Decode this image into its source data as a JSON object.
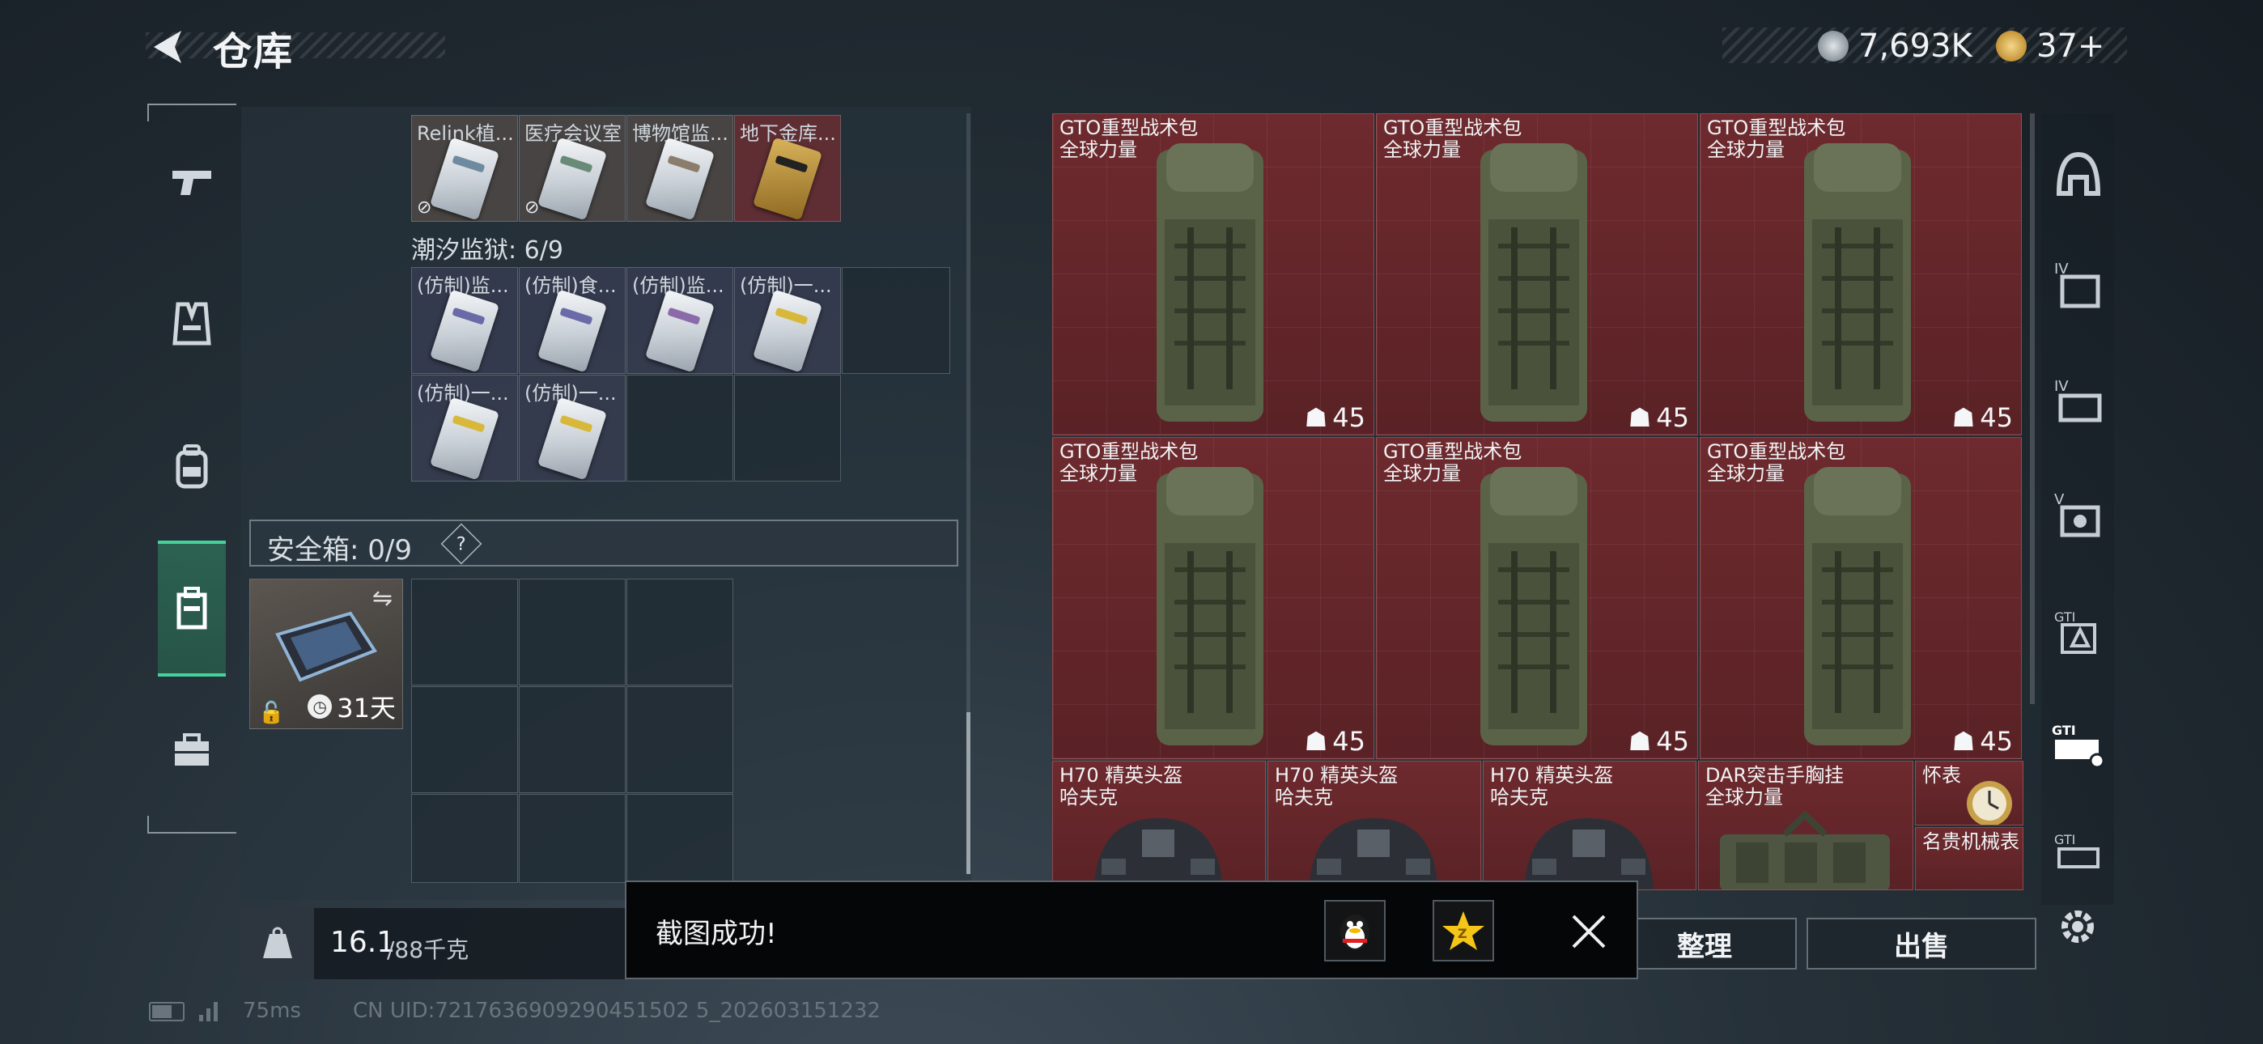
{
  "header": {
    "title": "仓库",
    "currency_primary": "7,693K",
    "currency_secondary": "37+"
  },
  "left_nav": [
    {
      "icon": "pistol-icon"
    },
    {
      "icon": "vest-icon"
    },
    {
      "icon": "backpack-icon"
    },
    {
      "icon": "container-icon",
      "active": true
    },
    {
      "icon": "briefcase-icon"
    }
  ],
  "storage": {
    "top_row_labels": [
      "Relink植...",
      "医疗会议室",
      "博物馆监...",
      "地下金库..."
    ],
    "prison_title": "潮汐监狱: 6/9",
    "prison_items": [
      "(仿制)监...",
      "(仿制)食...",
      "(仿制)监...",
      "(仿制)一...",
      "(仿制)一...",
      "(仿制)一..."
    ],
    "safebox_title": "安全箱: 0/9",
    "safebox_help": "?",
    "safebox_days": "31天",
    "weight_current": "16.1",
    "weight_max": "/88千克"
  },
  "items": {
    "backpacks": [
      {
        "name": "GTO重型战术包",
        "brand": "全球力量",
        "count": "45"
      },
      {
        "name": "GTO重型战术包",
        "brand": "全球力量",
        "count": "45"
      },
      {
        "name": "GTO重型战术包",
        "brand": "全球力量",
        "count": "45"
      },
      {
        "name": "GTO重型战术包",
        "brand": "全球力量",
        "count": "45"
      },
      {
        "name": "GTO重型战术包",
        "brand": "全球力量",
        "count": "45"
      },
      {
        "name": "GTO重型战术包",
        "brand": "全球力量",
        "count": "45"
      }
    ],
    "bottom_row": [
      {
        "name": "H70 精英头盔",
        "brand": "哈夫克"
      },
      {
        "name": "H70 精英头盔",
        "brand": "哈夫克"
      },
      {
        "name": "H70 精英头盔",
        "brand": "哈夫克"
      },
      {
        "name": "DAR突击手胸挂",
        "brand": "全球力量"
      },
      {
        "name": "怀表",
        "brand": ""
      },
      {
        "name": "名贵机械表",
        "brand": ""
      }
    ]
  },
  "right_nav": [
    {
      "icon": "helmet-category-icon"
    },
    {
      "icon": "armor-iv-icon",
      "label": "IV"
    },
    {
      "icon": "rig-iv-icon",
      "label": "IV"
    },
    {
      "icon": "armor-v-icon",
      "label": "V"
    },
    {
      "icon": "gti-armor-icon",
      "label": "GTI"
    },
    {
      "icon": "gti-rig-icon",
      "label": "GTI"
    },
    {
      "icon": "gti-backpack-icon",
      "label": "GTI"
    }
  ],
  "buttons": {
    "organize": "整理",
    "sell": "出售"
  },
  "toast": {
    "message": "截图成功!"
  },
  "footer": {
    "ping": "75ms",
    "uid": "CN UID:7217636909290451502 5_202603151232"
  },
  "colors": {
    "item_bg": "#5e2428",
    "active_nav": "#45d19a",
    "toast_bg": "#050607"
  }
}
